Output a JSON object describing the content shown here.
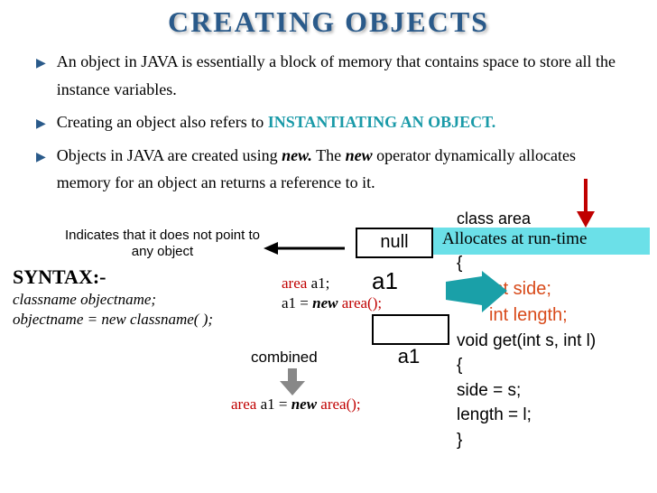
{
  "title": "CREATING OBJECTS",
  "bullets": [
    {
      "pre": "An object in JAVA is essentially a block of memory that contains space to store all the instance variables."
    },
    {
      "pre": "Creating an object also refers to ",
      "teal": "INSTANTIATING AN OBJECT."
    },
    {
      "pre": "Objects in JAVA are created using ",
      "bi1": "new.",
      "mid": " The ",
      "bi2": "new",
      "post": " operator dynamically allocates memory for an object an returns a reference to it."
    }
  ],
  "indicates": "Indicates that it does not point to any object",
  "null_label": "null",
  "alloc_text": "Allocates at run-time",
  "syntax_heading": "SYNTAX:-",
  "syntax_l1": "classname   objectname;",
  "syntax_l2": "objectname  =  new  classname( );",
  "decl": {
    "type": "area",
    "name": " a1;"
  },
  "assign": {
    "lhs": "a1 = ",
    "kw": "new ",
    "call": "area();"
  },
  "a1_label": "a1",
  "combined_label": "combined",
  "combined_code": {
    "type": "area",
    "mid": " a1 = ",
    "kw": "new ",
    "call": "area();"
  },
  "class_top": "class area",
  "class_open": "{",
  "field1": "int side;",
  "field2": "int length;",
  "method_sig": "void get(int s, int l)",
  "method_open": "   {",
  "stmt1": "     side = s;",
  "stmt2": "     length =  l;",
  "method_close": "   }"
}
